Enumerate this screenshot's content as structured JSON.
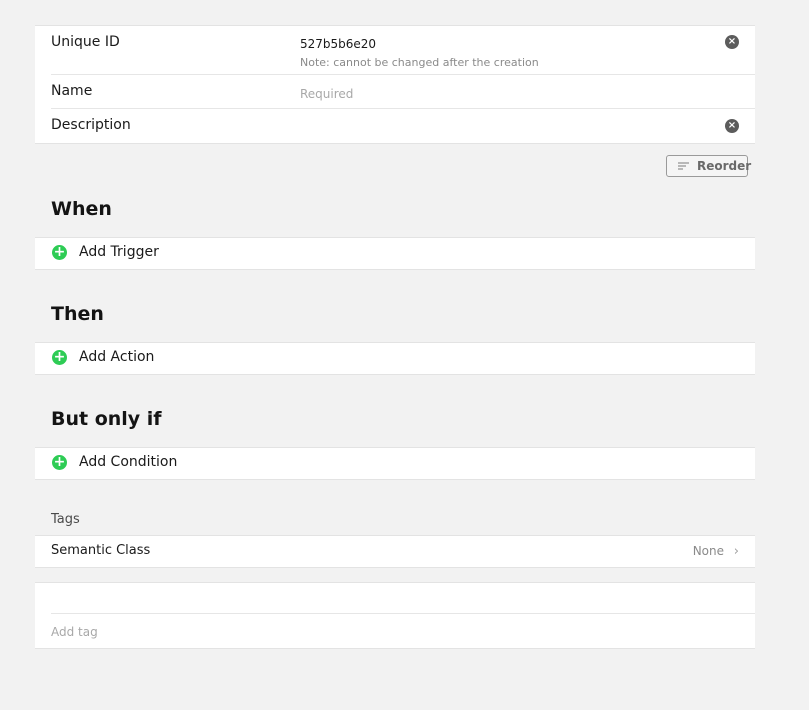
{
  "form": {
    "unique_id": {
      "label": "Unique ID",
      "value": "527b5b6e20",
      "note": "Note: cannot be changed after the creation"
    },
    "name": {
      "label": "Name",
      "placeholder": "Required"
    },
    "description": {
      "label": "Description",
      "value": ""
    }
  },
  "toolbar": {
    "reorder_label": "Reorder",
    "reorder_icon": "reorder-icon"
  },
  "sections": {
    "when": {
      "title": "When",
      "add_label": "Add Trigger"
    },
    "then": {
      "title": "Then",
      "add_label": "Add Action"
    },
    "only_if": {
      "title": "But only if",
      "add_label": "Add Condition"
    }
  },
  "tags": {
    "section_label": "Tags",
    "semantic_class_label": "Semantic Class",
    "semantic_class_value": "None",
    "add_tag_placeholder": "Add tag"
  },
  "colors": {
    "background": "#f2f2f2",
    "panel": "#ffffff",
    "add_icon": "#2ecc55",
    "clear_icon": "#5c5c5c"
  }
}
